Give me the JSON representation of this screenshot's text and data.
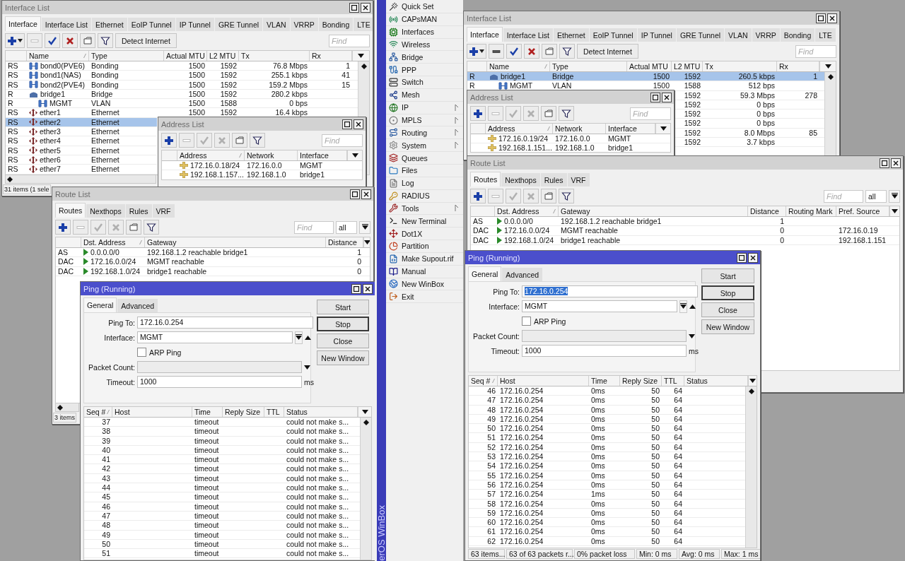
{
  "left_workspace": {
    "windows": [
      {
        "kind": "interface_list",
        "title": "Interface List",
        "active": false,
        "tabs": [
          {
            "label": "Interface",
            "selected": true
          },
          {
            "label": "Interface List",
            "selected": false
          },
          {
            "label": "Ethernet",
            "selected": false
          },
          {
            "label": "EoIP Tunnel",
            "selected": false
          },
          {
            "label": "IP Tunnel",
            "selected": false
          },
          {
            "label": "GRE Tunnel",
            "selected": false
          },
          {
            "label": "VLAN",
            "selected": false
          },
          {
            "label": "VRRP",
            "selected": false
          },
          {
            "label": "Bonding",
            "selected": false
          },
          {
            "label": "LTE",
            "selected": false
          }
        ],
        "tools": [
          {
            "kind": "add_menu",
            "disabled": false
          },
          {
            "kind": "remove",
            "disabled": true
          },
          {
            "kind": "enable",
            "disabled": false
          },
          {
            "kind": "disable",
            "disabled": false
          },
          {
            "kind": "comment",
            "disabled": false
          },
          {
            "kind": "filter",
            "disabled": false
          }
        ],
        "detect_button": "Detect Internet",
        "find_placeholder": "Find",
        "columns": [
          {
            "label": "Name",
            "sorted": true
          },
          {
            "label": "Type",
            "sorted": false
          },
          {
            "label": "Actual MTU",
            "sorted": false
          },
          {
            "label": "L2 MTU",
            "sorted": false
          },
          {
            "label": "Tx",
            "sorted": false
          },
          {
            "label": "Rx",
            "sorted": false
          }
        ],
        "rows": [
          {
            "flag": "RS",
            "kind": "bonding",
            "name": "bond0(PVE6)",
            "type": "Bonding",
            "actual_mtu": "1500",
            "l2_mtu": "1592",
            "tx": "76.8 Mbps",
            "rx": "1",
            "selected": false
          },
          {
            "flag": "RS",
            "kind": "bonding",
            "name": "bond1(NAS)",
            "type": "Bonding",
            "actual_mtu": "1500",
            "l2_mtu": "1592",
            "tx": "255.1 kbps",
            "rx": "41",
            "selected": false
          },
          {
            "flag": "RS",
            "kind": "bonding",
            "name": "bond2(PVE4)",
            "type": "Bonding",
            "actual_mtu": "1500",
            "l2_mtu": "1592",
            "tx": "159.2 Mbps",
            "rx": "15",
            "selected": false
          },
          {
            "flag": "R",
            "kind": "bridge",
            "name": "bridge1",
            "type": "Bridge",
            "actual_mtu": "1500",
            "l2_mtu": "1592",
            "tx": "280.2 kbps",
            "selected": false,
            "children": [
              {
                "flag": "R",
                "kind": "vlan",
                "name": "MGMT",
                "type": "VLAN",
                "actual_mtu": "1500",
                "l2_mtu": "1588",
                "tx": "0 bps",
                "selected": false
              }
            ]
          },
          {
            "flag": "RS",
            "kind": "ethernet",
            "name": "ether1",
            "type": "Ethernet",
            "actual_mtu": "1500",
            "l2_mtu": "1592",
            "tx": "16.4 kbps",
            "selected": false
          },
          {
            "flag": "RS",
            "kind": "ethernet",
            "name": "ether2",
            "type": "Ethernet",
            "selected": true
          },
          {
            "flag": "RS",
            "kind": "ethernet",
            "name": "ether3",
            "type": "Ethernet",
            "selected": false
          },
          {
            "flag": "RS",
            "kind": "ethernet",
            "name": "ether4",
            "type": "Ethernet",
            "selected": false
          },
          {
            "flag": "RS",
            "kind": "ethernet",
            "name": "ether5",
            "type": "Ethernet",
            "selected": false
          },
          {
            "flag": "RS",
            "kind": "ethernet",
            "name": "ether6",
            "type": "Ethernet",
            "selected": false
          },
          {
            "flag": "RS",
            "kind": "ethernet",
            "name": "ether7",
            "type": "Ethernet",
            "selected": false
          }
        ],
        "status": "31 items (1 sele"
      },
      {
        "kind": "address_list",
        "title": "Address List",
        "active": false,
        "tools": [
          {
            "kind": "add",
            "disabled": false
          },
          {
            "kind": "remove",
            "disabled": true
          },
          {
            "kind": "enable",
            "disabled": true
          },
          {
            "kind": "disable",
            "disabled": true
          },
          {
            "kind": "comment",
            "disabled": false
          },
          {
            "kind": "filter",
            "disabled": false
          }
        ],
        "find_placeholder": "Find",
        "columns": [
          {
            "label": "Address",
            "sorted": true
          },
          {
            "label": "Network",
            "sorted": false
          },
          {
            "label": "Interface",
            "sorted": false
          }
        ],
        "rows": [
          {
            "address": "172.16.0.18/24",
            "network": "172.16.0.0",
            "interface": "MGMT"
          },
          {
            "address": "192.168.1.157...",
            "network": "192.168.1.0",
            "interface": "bridge1"
          }
        ]
      },
      {
        "kind": "route_list",
        "title": "Route List",
        "active": false,
        "tabs": [
          {
            "label": "Routes",
            "selected": true
          },
          {
            "label": "Nexthops",
            "selected": false
          },
          {
            "label": "Rules",
            "selected": false
          },
          {
            "label": "VRF",
            "selected": false
          }
        ],
        "tools": [
          {
            "kind": "add",
            "disabled": false
          },
          {
            "kind": "remove",
            "disabled": true
          },
          {
            "kind": "enable",
            "disabled": true
          },
          {
            "kind": "disable",
            "disabled": true
          },
          {
            "kind": "comment",
            "disabled": false
          },
          {
            "kind": "filter",
            "disabled": false
          }
        ],
        "find_placeholder": "Find",
        "scope": "all",
        "columns": [
          {
            "label": "Dst. Address",
            "sorted": true
          },
          {
            "label": "Gateway",
            "sorted": false
          },
          {
            "label": "Distance",
            "sorted": false
          }
        ],
        "rows": [
          {
            "flag": "AS",
            "dst": "0.0.0.0/0",
            "gateway": "192.168.1.2 reachable bridge1",
            "distance": "1"
          },
          {
            "flag": "DAC",
            "dst": "172.16.0.0/24",
            "gateway": "MGMT reachable",
            "distance": "0"
          },
          {
            "flag": "DAC",
            "dst": "192.168.1.0/24",
            "gateway": "bridge1 reachable",
            "distance": "0"
          }
        ],
        "status": "3 items"
      },
      {
        "kind": "ping",
        "title": "Ping (Running)",
        "active": true,
        "tabs": [
          {
            "label": "General",
            "selected": true
          },
          {
            "label": "Advanced",
            "selected": false
          }
        ],
        "form": {
          "ping_to": {
            "label": "Ping To:",
            "value": "172.16.0.254",
            "value_selected": false
          },
          "interface": {
            "label": "Interface:",
            "value": "MGMT"
          },
          "arp_ping": {
            "label": "ARP Ping",
            "checked": false
          },
          "packet_count": {
            "label": "Packet Count:",
            "disabled": true
          },
          "timeout": {
            "label": "Timeout:",
            "value": "1000",
            "unit": "ms"
          }
        },
        "buttons": [
          {
            "label": "Start",
            "default": false
          },
          {
            "label": "Stop",
            "default": true
          },
          {
            "label": "Close",
            "default": false
          },
          {
            "label": "New Window",
            "default": false
          }
        ],
        "columns": [
          {
            "label": "Seq #",
            "sorted": true
          },
          {
            "label": "Host",
            "sorted": false
          },
          {
            "label": "Time",
            "sorted": false
          },
          {
            "label": "Reply Size",
            "sorted": false
          },
          {
            "label": "TTL",
            "sorted": false
          },
          {
            "label": "Status",
            "sorted": false
          }
        ],
        "rows": [
          {
            "seq": "37",
            "time": "timeout",
            "status": "could not make s..."
          },
          {
            "seq": "38",
            "time": "timeout",
            "status": "could not make s..."
          },
          {
            "seq": "39",
            "time": "timeout",
            "status": "could not make s..."
          },
          {
            "seq": "40",
            "time": "timeout",
            "status": "could not make s..."
          },
          {
            "seq": "41",
            "time": "timeout",
            "status": "could not make s..."
          },
          {
            "seq": "42",
            "time": "timeout",
            "status": "could not make s..."
          },
          {
            "seq": "43",
            "time": "timeout",
            "status": "could not make s..."
          },
          {
            "seq": "44",
            "time": "timeout",
            "status": "could not make s..."
          },
          {
            "seq": "45",
            "time": "timeout",
            "status": "could not make s..."
          },
          {
            "seq": "46",
            "time": "timeout",
            "status": "could not make s..."
          },
          {
            "seq": "47",
            "time": "timeout",
            "status": "could not make s..."
          },
          {
            "seq": "48",
            "time": "timeout",
            "status": "could not make s..."
          },
          {
            "seq": "49",
            "time": "timeout",
            "status": "could not make s..."
          },
          {
            "seq": "50",
            "time": "timeout",
            "status": "could not make s..."
          },
          {
            "seq": "51",
            "time": "timeout",
            "status": "could not make s..."
          }
        ]
      }
    ]
  },
  "menu": {
    "brand": "erOS WinBox",
    "items": [
      {
        "label": "Quick Set",
        "kind": "wand",
        "submenu": false
      },
      {
        "label": "CAPsMAN",
        "kind": "antenna",
        "submenu": false
      },
      {
        "label": "Interfaces",
        "kind": "card",
        "submenu": false
      },
      {
        "label": "Wireless",
        "kind": "wifi",
        "submenu": false
      },
      {
        "label": "Bridge",
        "kind": "bridge",
        "submenu": false
      },
      {
        "label": "PPP",
        "kind": "cable",
        "submenu": false
      },
      {
        "label": "Switch",
        "kind": "switch",
        "submenu": false
      },
      {
        "label": "Mesh",
        "kind": "mesh",
        "submenu": false
      },
      {
        "label": "IP",
        "kind": "ip",
        "submenu": true
      },
      {
        "label": "MPLS",
        "kind": "mpls",
        "submenu": true
      },
      {
        "label": "Routing",
        "kind": "routing",
        "submenu": true
      },
      {
        "label": "System",
        "kind": "gear",
        "submenu": true
      },
      {
        "label": "Queues",
        "kind": "queues",
        "submenu": false
      },
      {
        "label": "Files",
        "kind": "folder",
        "submenu": false
      },
      {
        "label": "Log",
        "kind": "log",
        "submenu": false
      },
      {
        "label": "RADIUS",
        "kind": "radius",
        "submenu": false
      },
      {
        "label": "Tools",
        "kind": "tools",
        "submenu": true
      },
      {
        "label": "New Terminal",
        "kind": "terminal",
        "submenu": false
      },
      {
        "label": "Dot1X",
        "kind": "dot1x",
        "submenu": false
      },
      {
        "label": "Partition",
        "kind": "partition",
        "submenu": false
      },
      {
        "label": "Make Supout.rif",
        "kind": "supout",
        "submenu": false
      },
      {
        "label": "Manual",
        "kind": "manual",
        "submenu": false
      },
      {
        "label": "New WinBox",
        "kind": "winbox",
        "submenu": false
      },
      {
        "label": "Exit",
        "kind": "exit",
        "submenu": false
      }
    ]
  },
  "right_workspace": {
    "windows": [
      {
        "kind": "interface_list",
        "title": "Interface List",
        "active": false,
        "tabs": [
          {
            "label": "Interface",
            "selected": true
          },
          {
            "label": "Interface List",
            "selected": false
          },
          {
            "label": "Ethernet",
            "selected": false
          },
          {
            "label": "EoIP Tunnel",
            "selected": false
          },
          {
            "label": "IP Tunnel",
            "selected": false
          },
          {
            "label": "GRE Tunnel",
            "selected": false
          },
          {
            "label": "VLAN",
            "selected": false
          },
          {
            "label": "VRRP",
            "selected": false
          },
          {
            "label": "Bonding",
            "selected": false
          },
          {
            "label": "LTE",
            "selected": false
          }
        ],
        "tools": [
          {
            "kind": "add_menu",
            "disabled": false
          },
          {
            "kind": "remove",
            "disabled": false
          },
          {
            "kind": "enable",
            "disabled": false
          },
          {
            "kind": "disable",
            "disabled": false
          },
          {
            "kind": "comment",
            "disabled": false
          },
          {
            "kind": "filter",
            "disabled": false
          }
        ],
        "detect_button": "Detect Internet",
        "find_placeholder": "Find",
        "columns": [
          {
            "label": "Name",
            "sorted": true
          },
          {
            "label": "Type",
            "sorted": false
          },
          {
            "label": "Actual MTU",
            "sorted": false
          },
          {
            "label": "L2 MTU",
            "sorted": false
          },
          {
            "label": "Tx",
            "sorted": false
          },
          {
            "label": "Rx",
            "sorted": false
          }
        ],
        "rows": [
          {
            "flag": "R",
            "kind": "bridge",
            "name": "bridge1",
            "type": "Bridge",
            "actual_mtu": "1500",
            "l2_mtu": "1592",
            "tx": "260.5 kbps",
            "rx": "1",
            "selected": true,
            "children": [
              {
                "flag": "R",
                "kind": "vlan",
                "name": "MGMT",
                "type": "VLAN",
                "actual_mtu": "1500",
                "l2_mtu": "1588",
                "tx": "512 bps",
                "selected": false
              }
            ]
          },
          {
            "l2_mtu": "1592",
            "tx": "59.3 Mbps",
            "rx": "278",
            "selected": false
          },
          {
            "l2_mtu": "1592",
            "tx": "0 bps",
            "selected": false
          },
          {
            "l2_mtu": "1592",
            "tx": "0 bps",
            "selected": false
          },
          {
            "l2_mtu": "1592",
            "tx": "0 bps",
            "selected": false
          },
          {
            "l2_mtu": "1592",
            "tx": "8.0 Mbps",
            "rx": "85",
            "selected": false
          },
          {
            "l2_mtu": "1592",
            "tx": "3.7 kbps",
            "selected": false
          }
        ]
      },
      {
        "kind": "address_list",
        "title": "Address List",
        "active": false,
        "tools": [
          {
            "kind": "add",
            "disabled": false
          },
          {
            "kind": "remove",
            "disabled": true
          },
          {
            "kind": "enable",
            "disabled": true
          },
          {
            "kind": "disable",
            "disabled": true
          },
          {
            "kind": "comment",
            "disabled": false
          },
          {
            "kind": "filter",
            "disabled": false
          }
        ],
        "find_placeholder": "Find",
        "columns": [
          {
            "label": "Address",
            "sorted": true
          },
          {
            "label": "Network",
            "sorted": false
          },
          {
            "label": "Interface",
            "sorted": false
          }
        ],
        "rows": [
          {
            "address": "172.16.0.19/24",
            "network": "172.16.0.0",
            "interface": "MGMT"
          },
          {
            "address": "192.168.1.151...",
            "network": "192.168.1.0",
            "interface": "bridge1"
          }
        ]
      },
      {
        "kind": "route_list",
        "title": "Route List",
        "active": false,
        "tabs": [
          {
            "label": "Routes",
            "selected": true
          },
          {
            "label": "Nexthops",
            "selected": false
          },
          {
            "label": "Rules",
            "selected": false
          },
          {
            "label": "VRF",
            "selected": false
          }
        ],
        "tools": [
          {
            "kind": "add",
            "disabled": false
          },
          {
            "kind": "remove",
            "disabled": true
          },
          {
            "kind": "enable",
            "disabled": true
          },
          {
            "kind": "disable",
            "disabled": true
          },
          {
            "kind": "comment",
            "disabled": false
          },
          {
            "kind": "filter",
            "disabled": false
          }
        ],
        "find_placeholder": "Find",
        "scope": "all",
        "columns": [
          {
            "label": "Dst. Address",
            "sorted": true
          },
          {
            "label": "Gateway",
            "sorted": false
          },
          {
            "label": "Distance",
            "sorted": false
          },
          {
            "label": "Routing Mark",
            "sorted": false
          },
          {
            "label": "Pref. Source",
            "sorted": false
          }
        ],
        "rows": [
          {
            "flag": "AS",
            "dst": "0.0.0.0/0",
            "gateway": "192.168.1.2 reachable bridge1",
            "distance": "1"
          },
          {
            "flag": "DAC",
            "dst": "172.16.0.0/24",
            "gateway": "MGMT reachable",
            "distance": "0",
            "pref_source": "172.16.0.19"
          },
          {
            "flag": "DAC",
            "dst": "192.168.1.0/24",
            "gateway": "bridge1 reachable",
            "distance": "0",
            "pref_source": "192.168.1.151"
          }
        ]
      },
      {
        "kind": "ping",
        "title": "Ping (Running)",
        "active": true,
        "tabs": [
          {
            "label": "General",
            "selected": true
          },
          {
            "label": "Advanced",
            "selected": false
          }
        ],
        "form": {
          "ping_to": {
            "label": "Ping To:",
            "value": "172.16.0.254",
            "value_selected": true
          },
          "interface": {
            "label": "Interface:",
            "value": "MGMT"
          },
          "arp_ping": {
            "label": "ARP Ping",
            "checked": false
          },
          "packet_count": {
            "label": "Packet Count:",
            "disabled": true
          },
          "timeout": {
            "label": "Timeout:",
            "value": "1000",
            "unit": "ms"
          }
        },
        "buttons": [
          {
            "label": "Start",
            "default": false
          },
          {
            "label": "Stop",
            "default": true
          },
          {
            "label": "Close",
            "default": false
          },
          {
            "label": "New Window",
            "default": false
          }
        ],
        "columns": [
          {
            "label": "Seq #",
            "sorted": true
          },
          {
            "label": "Host",
            "sorted": false
          },
          {
            "label": "Time",
            "sorted": false
          },
          {
            "label": "Reply Size",
            "sorted": false
          },
          {
            "label": "TTL",
            "sorted": false
          },
          {
            "label": "Status",
            "sorted": false
          }
        ],
        "rows": [
          {
            "seq": "46",
            "host": "172.16.0.254",
            "time": "0ms",
            "reply_size": "50",
            "ttl": "64"
          },
          {
            "seq": "47",
            "host": "172.16.0.254",
            "time": "0ms",
            "reply_size": "50",
            "ttl": "64"
          },
          {
            "seq": "48",
            "host": "172.16.0.254",
            "time": "0ms",
            "reply_size": "50",
            "ttl": "64"
          },
          {
            "seq": "49",
            "host": "172.16.0.254",
            "time": "0ms",
            "reply_size": "50",
            "ttl": "64"
          },
          {
            "seq": "50",
            "host": "172.16.0.254",
            "time": "0ms",
            "reply_size": "50",
            "ttl": "64"
          },
          {
            "seq": "51",
            "host": "172.16.0.254",
            "time": "0ms",
            "reply_size": "50",
            "ttl": "64"
          },
          {
            "seq": "52",
            "host": "172.16.0.254",
            "time": "0ms",
            "reply_size": "50",
            "ttl": "64"
          },
          {
            "seq": "53",
            "host": "172.16.0.254",
            "time": "0ms",
            "reply_size": "50",
            "ttl": "64"
          },
          {
            "seq": "54",
            "host": "172.16.0.254",
            "time": "0ms",
            "reply_size": "50",
            "ttl": "64"
          },
          {
            "seq": "55",
            "host": "172.16.0.254",
            "time": "0ms",
            "reply_size": "50",
            "ttl": "64"
          },
          {
            "seq": "56",
            "host": "172.16.0.254",
            "time": "0ms",
            "reply_size": "50",
            "ttl": "64"
          },
          {
            "seq": "57",
            "host": "172.16.0.254",
            "time": "1ms",
            "reply_size": "50",
            "ttl": "64"
          },
          {
            "seq": "58",
            "host": "172.16.0.254",
            "time": "0ms",
            "reply_size": "50",
            "ttl": "64"
          },
          {
            "seq": "59",
            "host": "172.16.0.254",
            "time": "0ms",
            "reply_size": "50",
            "ttl": "64"
          },
          {
            "seq": "60",
            "host": "172.16.0.254",
            "time": "0ms",
            "reply_size": "50",
            "ttl": "64"
          },
          {
            "seq": "61",
            "host": "172.16.0.254",
            "time": "0ms",
            "reply_size": "50",
            "ttl": "64"
          },
          {
            "seq": "62",
            "host": "172.16.0.254",
            "time": "0ms",
            "reply_size": "50",
            "ttl": "64"
          }
        ],
        "status": [
          "63 items...",
          "63 of 63 packets r...",
          "0% packet loss",
          "Min: 0 ms",
          "Avg: 0 ms",
          "Max: 1 ms"
        ]
      }
    ]
  }
}
